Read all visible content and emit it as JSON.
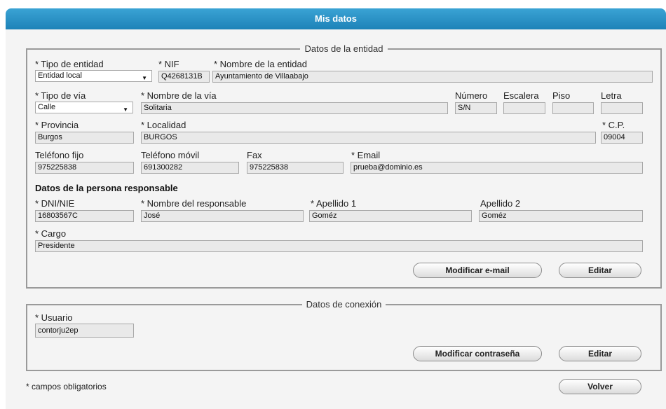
{
  "header": {
    "title": "Mis datos"
  },
  "entidad": {
    "legend": "Datos de la entidad",
    "tipo_entidad": {
      "label": "* Tipo de entidad",
      "value": "Entidad local"
    },
    "nif": {
      "label": "* NIF",
      "value": "Q4268131B"
    },
    "nombre_entidad": {
      "label": "* Nombre de la entidad",
      "value": "Ayuntamiento de Villaabajo"
    },
    "tipo_via": {
      "label": "* Tipo de vía",
      "value": "Calle"
    },
    "nombre_via": {
      "label": "* Nombre de la vía",
      "value": "Solitaria"
    },
    "numero": {
      "label": "Número",
      "value": "S/N"
    },
    "escalera": {
      "label": "Escalera",
      "value": ""
    },
    "piso": {
      "label": "Piso",
      "value": ""
    },
    "letra": {
      "label": "Letra",
      "value": ""
    },
    "provincia": {
      "label": "* Provincia",
      "value": "Burgos"
    },
    "localidad": {
      "label": "* Localidad",
      "value": "BURGOS"
    },
    "cp": {
      "label": "* C.P.",
      "value": "09004"
    },
    "telefono_fijo": {
      "label": "Teléfono fijo",
      "value": "975225838"
    },
    "telefono_movil": {
      "label": "Teléfono móvil",
      "value": "691300282"
    },
    "fax": {
      "label": "Fax",
      "value": "975225838"
    },
    "email": {
      "label": "* Email",
      "value": "prueba@dominio.es"
    },
    "responsable_title": "Datos de la persona responsable",
    "dni": {
      "label": "* DNI/NIE",
      "value": "16803567C"
    },
    "nombre_responsable": {
      "label": "* Nombre del responsable",
      "value": "José"
    },
    "apellido1": {
      "label": "* Apellido 1",
      "value": "Goméz"
    },
    "apellido2": {
      "label": "Apellido 2",
      "value": "Goméz"
    },
    "cargo": {
      "label": "* Cargo",
      "value": "Presidente"
    },
    "modificar_email_label": "Modificar e-mail",
    "editar_label": "Editar"
  },
  "conexion": {
    "legend": "Datos de conexión",
    "usuario": {
      "label": "* Usuario",
      "value": "contorju2ep"
    },
    "modificar_contrasena_label": "Modificar contraseña",
    "editar_label": "Editar"
  },
  "footer": {
    "note": "* campos obligatorios",
    "volver_label": "Volver"
  },
  "colors": {
    "header_blue": "#1d82b8",
    "panel_bg": "#f4f4f4",
    "field_bg": "#e9e9e9"
  }
}
